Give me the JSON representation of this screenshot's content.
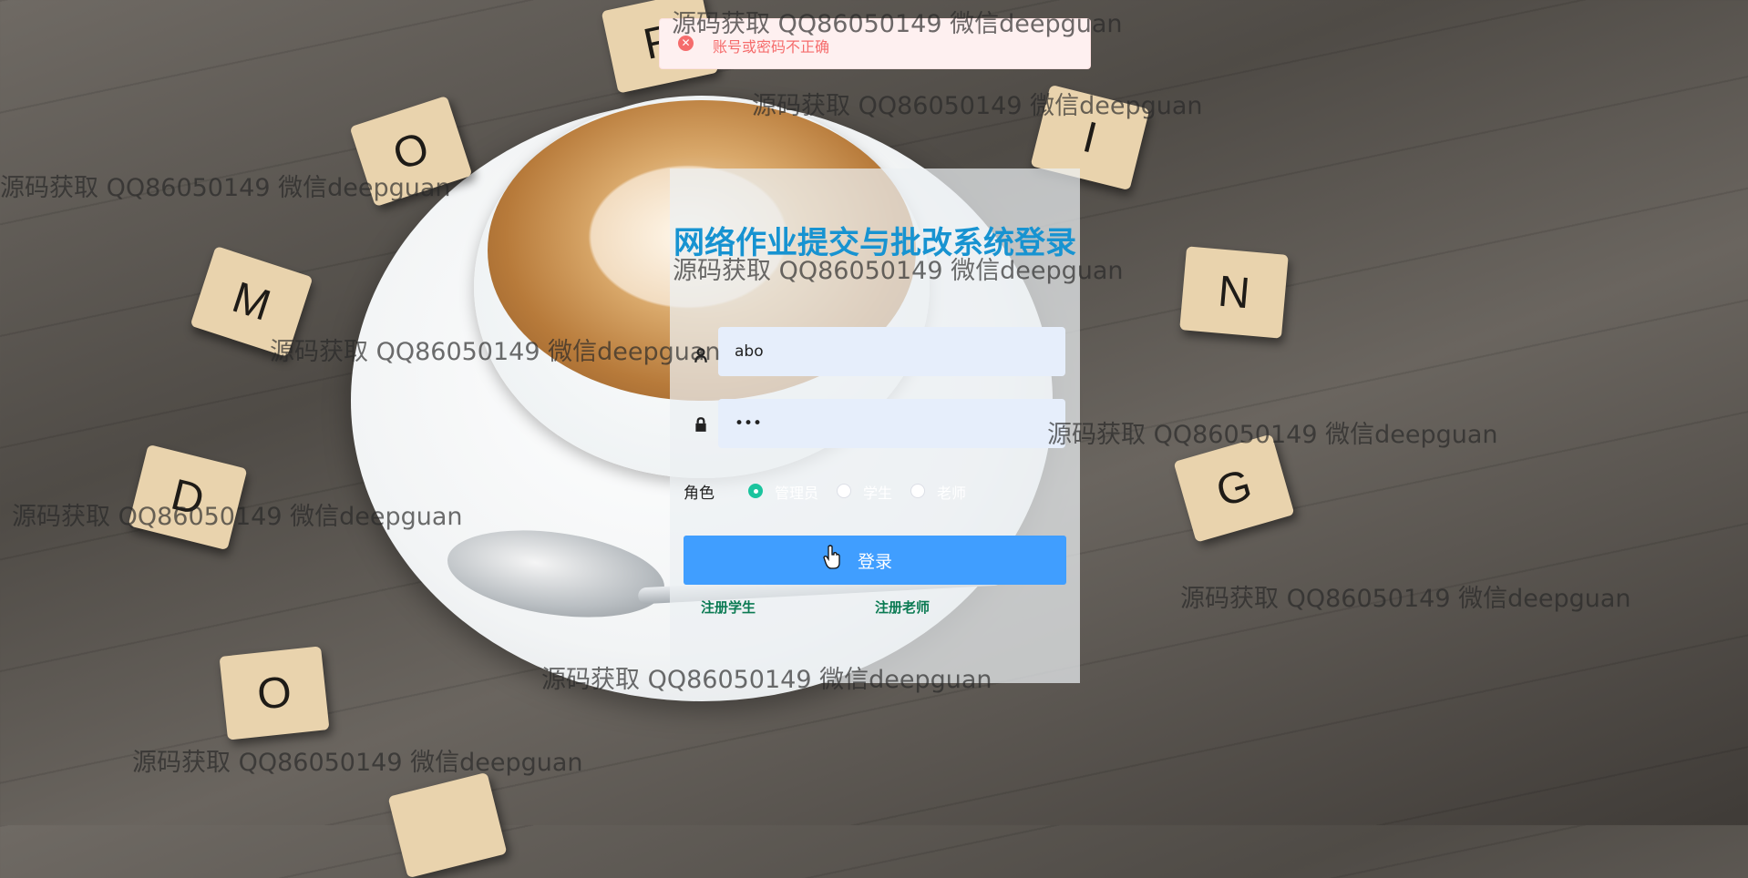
{
  "toast": {
    "message": "账号或密码不正确",
    "icon": "error-circle-icon",
    "color": "#f56c6c"
  },
  "login": {
    "title": "网络作业提交与批改系统登录",
    "username_value": "abo",
    "password_value": "•••",
    "role_label": "角色",
    "roles": [
      "管理员",
      "学生",
      "老师"
    ],
    "selected_role": "管理员",
    "submit_label": "登录",
    "register_student": "注册学生",
    "register_teacher": "注册老师",
    "accent_color": "#409eff",
    "title_color": "#1793d1"
  },
  "background": {
    "tiles": [
      "R",
      "O",
      "M",
      "D",
      "O",
      "I",
      "N",
      "G"
    ]
  },
  "watermark": "源码获取 QQ86050149 微信deepguan"
}
